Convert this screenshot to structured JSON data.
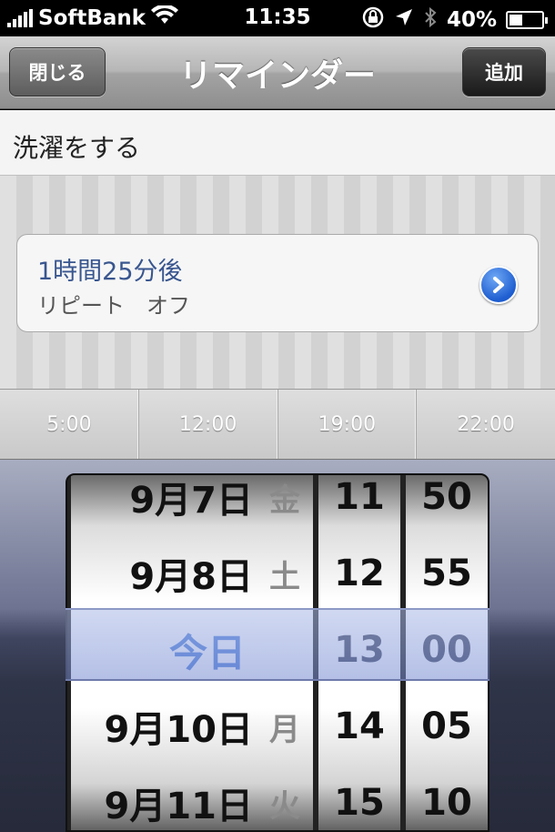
{
  "status_bar": {
    "carrier": "SoftBank",
    "time": "11:35",
    "battery": "40%",
    "battery_level": 0.4,
    "icons": [
      "signal-icon",
      "wifi-icon",
      "rotation-lock-icon",
      "location-icon",
      "bluetooth-icon",
      "battery-icon"
    ]
  },
  "navbar": {
    "title": "リマインダー",
    "close_label": "閉じる",
    "add_label": "追加"
  },
  "reminder": {
    "title": "洗濯をする",
    "alarm_time": "1時間25分後",
    "repeat": "リピート　オフ"
  },
  "time_shortcuts": [
    "5:00",
    "12:00",
    "19:00",
    "22:00"
  ],
  "picker": {
    "dates": [
      {
        "date": "9月7日",
        "dow": "金"
      },
      {
        "date": "9月8日",
        "dow": "土"
      },
      {
        "date": "今日",
        "dow": "",
        "selected": true
      },
      {
        "date": "9月10日",
        "dow": "月"
      },
      {
        "date": "9月11日",
        "dow": "火"
      }
    ],
    "hours": [
      "11",
      "12",
      "13",
      "14",
      "15"
    ],
    "minutes": [
      "50",
      "55",
      "00",
      "05",
      "10"
    ]
  },
  "colors": {
    "accent_blue": "#4e7fd9",
    "link_blue": "#39568f"
  }
}
